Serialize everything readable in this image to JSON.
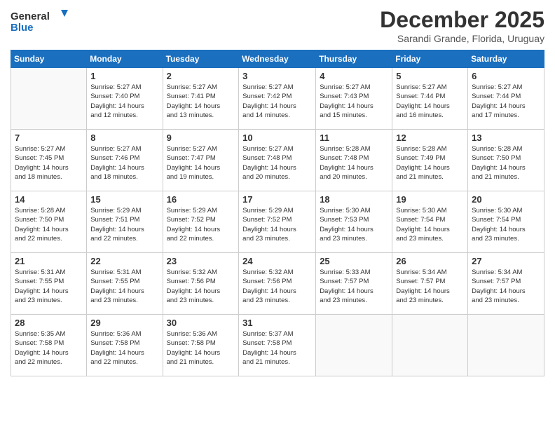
{
  "logo": {
    "line1": "General",
    "line2": "Blue"
  },
  "title": "December 2025",
  "location": "Sarandi Grande, Florida, Uruguay",
  "days_header": [
    "Sunday",
    "Monday",
    "Tuesday",
    "Wednesday",
    "Thursday",
    "Friday",
    "Saturday"
  ],
  "weeks": [
    [
      {
        "day": "",
        "sunrise": "",
        "sunset": "",
        "daylight": ""
      },
      {
        "day": "1",
        "sunrise": "Sunrise: 5:27 AM",
        "sunset": "Sunset: 7:40 PM",
        "daylight": "Daylight: 14 hours and 12 minutes."
      },
      {
        "day": "2",
        "sunrise": "Sunrise: 5:27 AM",
        "sunset": "Sunset: 7:41 PM",
        "daylight": "Daylight: 14 hours and 13 minutes."
      },
      {
        "day": "3",
        "sunrise": "Sunrise: 5:27 AM",
        "sunset": "Sunset: 7:42 PM",
        "daylight": "Daylight: 14 hours and 14 minutes."
      },
      {
        "day": "4",
        "sunrise": "Sunrise: 5:27 AM",
        "sunset": "Sunset: 7:43 PM",
        "daylight": "Daylight: 14 hours and 15 minutes."
      },
      {
        "day": "5",
        "sunrise": "Sunrise: 5:27 AM",
        "sunset": "Sunset: 7:44 PM",
        "daylight": "Daylight: 14 hours and 16 minutes."
      },
      {
        "day": "6",
        "sunrise": "Sunrise: 5:27 AM",
        "sunset": "Sunset: 7:44 PM",
        "daylight": "Daylight: 14 hours and 17 minutes."
      }
    ],
    [
      {
        "day": "7",
        "sunrise": "Sunrise: 5:27 AM",
        "sunset": "Sunset: 7:45 PM",
        "daylight": "Daylight: 14 hours and 18 minutes."
      },
      {
        "day": "8",
        "sunrise": "Sunrise: 5:27 AM",
        "sunset": "Sunset: 7:46 PM",
        "daylight": "Daylight: 14 hours and 18 minutes."
      },
      {
        "day": "9",
        "sunrise": "Sunrise: 5:27 AM",
        "sunset": "Sunset: 7:47 PM",
        "daylight": "Daylight: 14 hours and 19 minutes."
      },
      {
        "day": "10",
        "sunrise": "Sunrise: 5:27 AM",
        "sunset": "Sunset: 7:48 PM",
        "daylight": "Daylight: 14 hours and 20 minutes."
      },
      {
        "day": "11",
        "sunrise": "Sunrise: 5:28 AM",
        "sunset": "Sunset: 7:48 PM",
        "daylight": "Daylight: 14 hours and 20 minutes."
      },
      {
        "day": "12",
        "sunrise": "Sunrise: 5:28 AM",
        "sunset": "Sunset: 7:49 PM",
        "daylight": "Daylight: 14 hours and 21 minutes."
      },
      {
        "day": "13",
        "sunrise": "Sunrise: 5:28 AM",
        "sunset": "Sunset: 7:50 PM",
        "daylight": "Daylight: 14 hours and 21 minutes."
      }
    ],
    [
      {
        "day": "14",
        "sunrise": "Sunrise: 5:28 AM",
        "sunset": "Sunset: 7:50 PM",
        "daylight": "Daylight: 14 hours and 22 minutes."
      },
      {
        "day": "15",
        "sunrise": "Sunrise: 5:29 AM",
        "sunset": "Sunset: 7:51 PM",
        "daylight": "Daylight: 14 hours and 22 minutes."
      },
      {
        "day": "16",
        "sunrise": "Sunrise: 5:29 AM",
        "sunset": "Sunset: 7:52 PM",
        "daylight": "Daylight: 14 hours and 22 minutes."
      },
      {
        "day": "17",
        "sunrise": "Sunrise: 5:29 AM",
        "sunset": "Sunset: 7:52 PM",
        "daylight": "Daylight: 14 hours and 23 minutes."
      },
      {
        "day": "18",
        "sunrise": "Sunrise: 5:30 AM",
        "sunset": "Sunset: 7:53 PM",
        "daylight": "Daylight: 14 hours and 23 minutes."
      },
      {
        "day": "19",
        "sunrise": "Sunrise: 5:30 AM",
        "sunset": "Sunset: 7:54 PM",
        "daylight": "Daylight: 14 hours and 23 minutes."
      },
      {
        "day": "20",
        "sunrise": "Sunrise: 5:30 AM",
        "sunset": "Sunset: 7:54 PM",
        "daylight": "Daylight: 14 hours and 23 minutes."
      }
    ],
    [
      {
        "day": "21",
        "sunrise": "Sunrise: 5:31 AM",
        "sunset": "Sunset: 7:55 PM",
        "daylight": "Daylight: 14 hours and 23 minutes."
      },
      {
        "day": "22",
        "sunrise": "Sunrise: 5:31 AM",
        "sunset": "Sunset: 7:55 PM",
        "daylight": "Daylight: 14 hours and 23 minutes."
      },
      {
        "day": "23",
        "sunrise": "Sunrise: 5:32 AM",
        "sunset": "Sunset: 7:56 PM",
        "daylight": "Daylight: 14 hours and 23 minutes."
      },
      {
        "day": "24",
        "sunrise": "Sunrise: 5:32 AM",
        "sunset": "Sunset: 7:56 PM",
        "daylight": "Daylight: 14 hours and 23 minutes."
      },
      {
        "day": "25",
        "sunrise": "Sunrise: 5:33 AM",
        "sunset": "Sunset: 7:57 PM",
        "daylight": "Daylight: 14 hours and 23 minutes."
      },
      {
        "day": "26",
        "sunrise": "Sunrise: 5:34 AM",
        "sunset": "Sunset: 7:57 PM",
        "daylight": "Daylight: 14 hours and 23 minutes."
      },
      {
        "day": "27",
        "sunrise": "Sunrise: 5:34 AM",
        "sunset": "Sunset: 7:57 PM",
        "daylight": "Daylight: 14 hours and 23 minutes."
      }
    ],
    [
      {
        "day": "28",
        "sunrise": "Sunrise: 5:35 AM",
        "sunset": "Sunset: 7:58 PM",
        "daylight": "Daylight: 14 hours and 22 minutes."
      },
      {
        "day": "29",
        "sunrise": "Sunrise: 5:36 AM",
        "sunset": "Sunset: 7:58 PM",
        "daylight": "Daylight: 14 hours and 22 minutes."
      },
      {
        "day": "30",
        "sunrise": "Sunrise: 5:36 AM",
        "sunset": "Sunset: 7:58 PM",
        "daylight": "Daylight: 14 hours and 21 minutes."
      },
      {
        "day": "31",
        "sunrise": "Sunrise: 5:37 AM",
        "sunset": "Sunset: 7:58 PM",
        "daylight": "Daylight: 14 hours and 21 minutes."
      },
      {
        "day": "",
        "sunrise": "",
        "sunset": "",
        "daylight": ""
      },
      {
        "day": "",
        "sunrise": "",
        "sunset": "",
        "daylight": ""
      },
      {
        "day": "",
        "sunrise": "",
        "sunset": "",
        "daylight": ""
      }
    ]
  ]
}
